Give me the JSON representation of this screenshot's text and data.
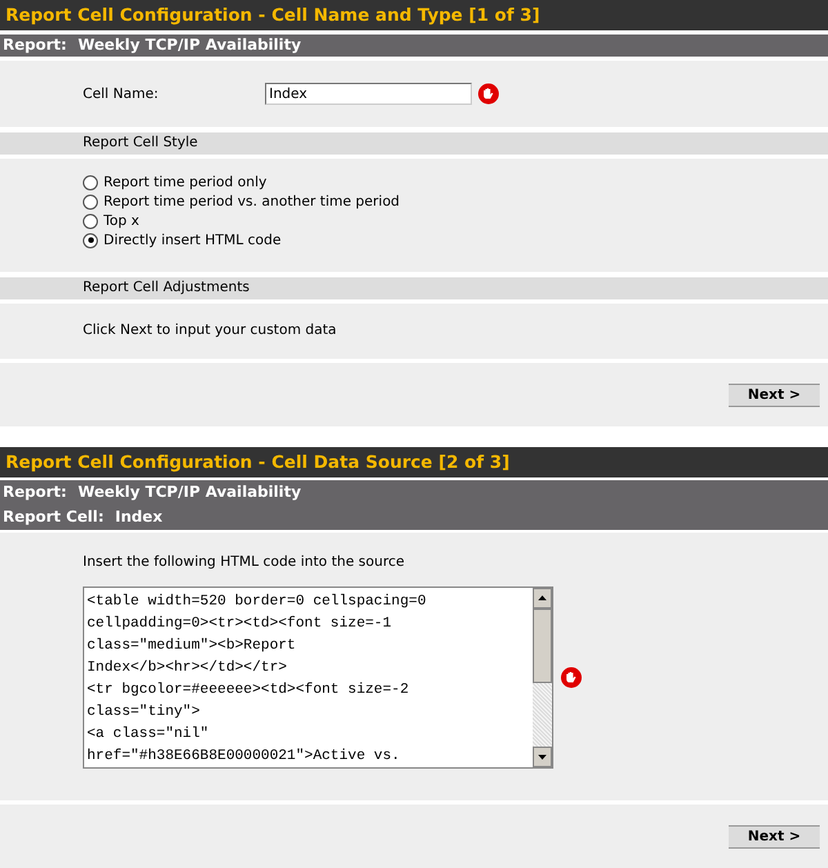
{
  "step1": {
    "title": "Report Cell Configuration - Cell Name and Type [1 of 3]",
    "report": {
      "label": "Report:",
      "value": "Weekly TCP/IP Availability"
    },
    "cell_name": {
      "label": "Cell Name:",
      "value": "Index"
    },
    "style_section": "Report Cell Style",
    "styles": [
      {
        "label": "Report time period only",
        "selected": false
      },
      {
        "label": "Report time period vs. another time period",
        "selected": false
      },
      {
        "label": "Top x",
        "selected": false
      },
      {
        "label": "Directly insert HTML code",
        "selected": true
      }
    ],
    "adjust_section": "Report Cell Adjustments",
    "hint": "Click Next to input your custom data",
    "button": "Next >"
  },
  "step2": {
    "title": "Report Cell Configuration - Cell Data Source [2 of 3]",
    "info": [
      {
        "label": "Report:",
        "value": "Weekly TCP/IP Availability"
      },
      {
        "label": "Report Cell:",
        "value": "Index"
      }
    ],
    "instruction": "Insert the following HTML code into the source",
    "code_lines": [
      "<table width=520 border=0 cellspacing=0",
      "cellpadding=0><tr><td><font size=-1",
      "class=\"medium\"><b>Report",
      "Index</b><hr></td></tr>",
      "<tr bgcolor=#eeeeee><td><font size=-2",
      "class=\"tiny\">",
      "<a class=\"nil\"",
      "href=\"#h38E66B8E00000021\">Active vs."
    ],
    "button": "Next >"
  }
}
